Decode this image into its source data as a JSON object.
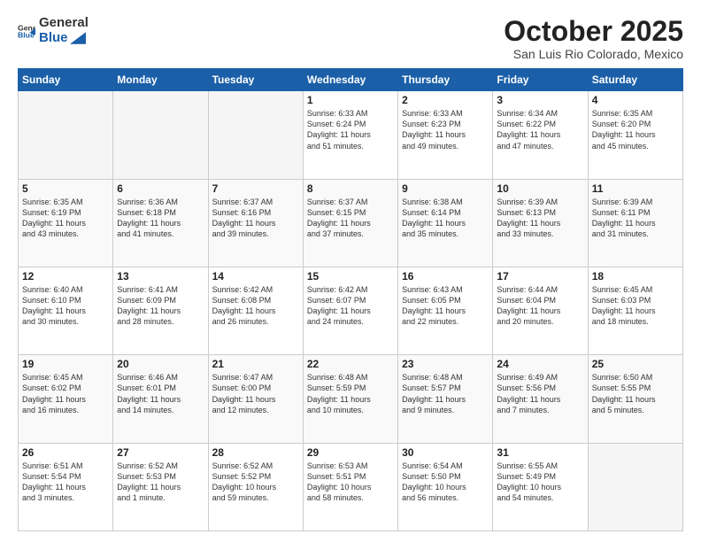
{
  "header": {
    "logo_general": "General",
    "logo_blue": "Blue",
    "title": "October 2025",
    "subtitle": "San Luis Rio Colorado, Mexico"
  },
  "weekdays": [
    "Sunday",
    "Monday",
    "Tuesday",
    "Wednesday",
    "Thursday",
    "Friday",
    "Saturday"
  ],
  "weeks": [
    [
      {
        "day": "",
        "info": ""
      },
      {
        "day": "",
        "info": ""
      },
      {
        "day": "",
        "info": ""
      },
      {
        "day": "1",
        "info": "Sunrise: 6:33 AM\nSunset: 6:24 PM\nDaylight: 11 hours\nand 51 minutes."
      },
      {
        "day": "2",
        "info": "Sunrise: 6:33 AM\nSunset: 6:23 PM\nDaylight: 11 hours\nand 49 minutes."
      },
      {
        "day": "3",
        "info": "Sunrise: 6:34 AM\nSunset: 6:22 PM\nDaylight: 11 hours\nand 47 minutes."
      },
      {
        "day": "4",
        "info": "Sunrise: 6:35 AM\nSunset: 6:20 PM\nDaylight: 11 hours\nand 45 minutes."
      }
    ],
    [
      {
        "day": "5",
        "info": "Sunrise: 6:35 AM\nSunset: 6:19 PM\nDaylight: 11 hours\nand 43 minutes."
      },
      {
        "day": "6",
        "info": "Sunrise: 6:36 AM\nSunset: 6:18 PM\nDaylight: 11 hours\nand 41 minutes."
      },
      {
        "day": "7",
        "info": "Sunrise: 6:37 AM\nSunset: 6:16 PM\nDaylight: 11 hours\nand 39 minutes."
      },
      {
        "day": "8",
        "info": "Sunrise: 6:37 AM\nSunset: 6:15 PM\nDaylight: 11 hours\nand 37 minutes."
      },
      {
        "day": "9",
        "info": "Sunrise: 6:38 AM\nSunset: 6:14 PM\nDaylight: 11 hours\nand 35 minutes."
      },
      {
        "day": "10",
        "info": "Sunrise: 6:39 AM\nSunset: 6:13 PM\nDaylight: 11 hours\nand 33 minutes."
      },
      {
        "day": "11",
        "info": "Sunrise: 6:39 AM\nSunset: 6:11 PM\nDaylight: 11 hours\nand 31 minutes."
      }
    ],
    [
      {
        "day": "12",
        "info": "Sunrise: 6:40 AM\nSunset: 6:10 PM\nDaylight: 11 hours\nand 30 minutes."
      },
      {
        "day": "13",
        "info": "Sunrise: 6:41 AM\nSunset: 6:09 PM\nDaylight: 11 hours\nand 28 minutes."
      },
      {
        "day": "14",
        "info": "Sunrise: 6:42 AM\nSunset: 6:08 PM\nDaylight: 11 hours\nand 26 minutes."
      },
      {
        "day": "15",
        "info": "Sunrise: 6:42 AM\nSunset: 6:07 PM\nDaylight: 11 hours\nand 24 minutes."
      },
      {
        "day": "16",
        "info": "Sunrise: 6:43 AM\nSunset: 6:05 PM\nDaylight: 11 hours\nand 22 minutes."
      },
      {
        "day": "17",
        "info": "Sunrise: 6:44 AM\nSunset: 6:04 PM\nDaylight: 11 hours\nand 20 minutes."
      },
      {
        "day": "18",
        "info": "Sunrise: 6:45 AM\nSunset: 6:03 PM\nDaylight: 11 hours\nand 18 minutes."
      }
    ],
    [
      {
        "day": "19",
        "info": "Sunrise: 6:45 AM\nSunset: 6:02 PM\nDaylight: 11 hours\nand 16 minutes."
      },
      {
        "day": "20",
        "info": "Sunrise: 6:46 AM\nSunset: 6:01 PM\nDaylight: 11 hours\nand 14 minutes."
      },
      {
        "day": "21",
        "info": "Sunrise: 6:47 AM\nSunset: 6:00 PM\nDaylight: 11 hours\nand 12 minutes."
      },
      {
        "day": "22",
        "info": "Sunrise: 6:48 AM\nSunset: 5:59 PM\nDaylight: 11 hours\nand 10 minutes."
      },
      {
        "day": "23",
        "info": "Sunrise: 6:48 AM\nSunset: 5:57 PM\nDaylight: 11 hours\nand 9 minutes."
      },
      {
        "day": "24",
        "info": "Sunrise: 6:49 AM\nSunset: 5:56 PM\nDaylight: 11 hours\nand 7 minutes."
      },
      {
        "day": "25",
        "info": "Sunrise: 6:50 AM\nSunset: 5:55 PM\nDaylight: 11 hours\nand 5 minutes."
      }
    ],
    [
      {
        "day": "26",
        "info": "Sunrise: 6:51 AM\nSunset: 5:54 PM\nDaylight: 11 hours\nand 3 minutes."
      },
      {
        "day": "27",
        "info": "Sunrise: 6:52 AM\nSunset: 5:53 PM\nDaylight: 11 hours\nand 1 minute."
      },
      {
        "day": "28",
        "info": "Sunrise: 6:52 AM\nSunset: 5:52 PM\nDaylight: 10 hours\nand 59 minutes."
      },
      {
        "day": "29",
        "info": "Sunrise: 6:53 AM\nSunset: 5:51 PM\nDaylight: 10 hours\nand 58 minutes."
      },
      {
        "day": "30",
        "info": "Sunrise: 6:54 AM\nSunset: 5:50 PM\nDaylight: 10 hours\nand 56 minutes."
      },
      {
        "day": "31",
        "info": "Sunrise: 6:55 AM\nSunset: 5:49 PM\nDaylight: 10 hours\nand 54 minutes."
      },
      {
        "day": "",
        "info": ""
      }
    ]
  ]
}
